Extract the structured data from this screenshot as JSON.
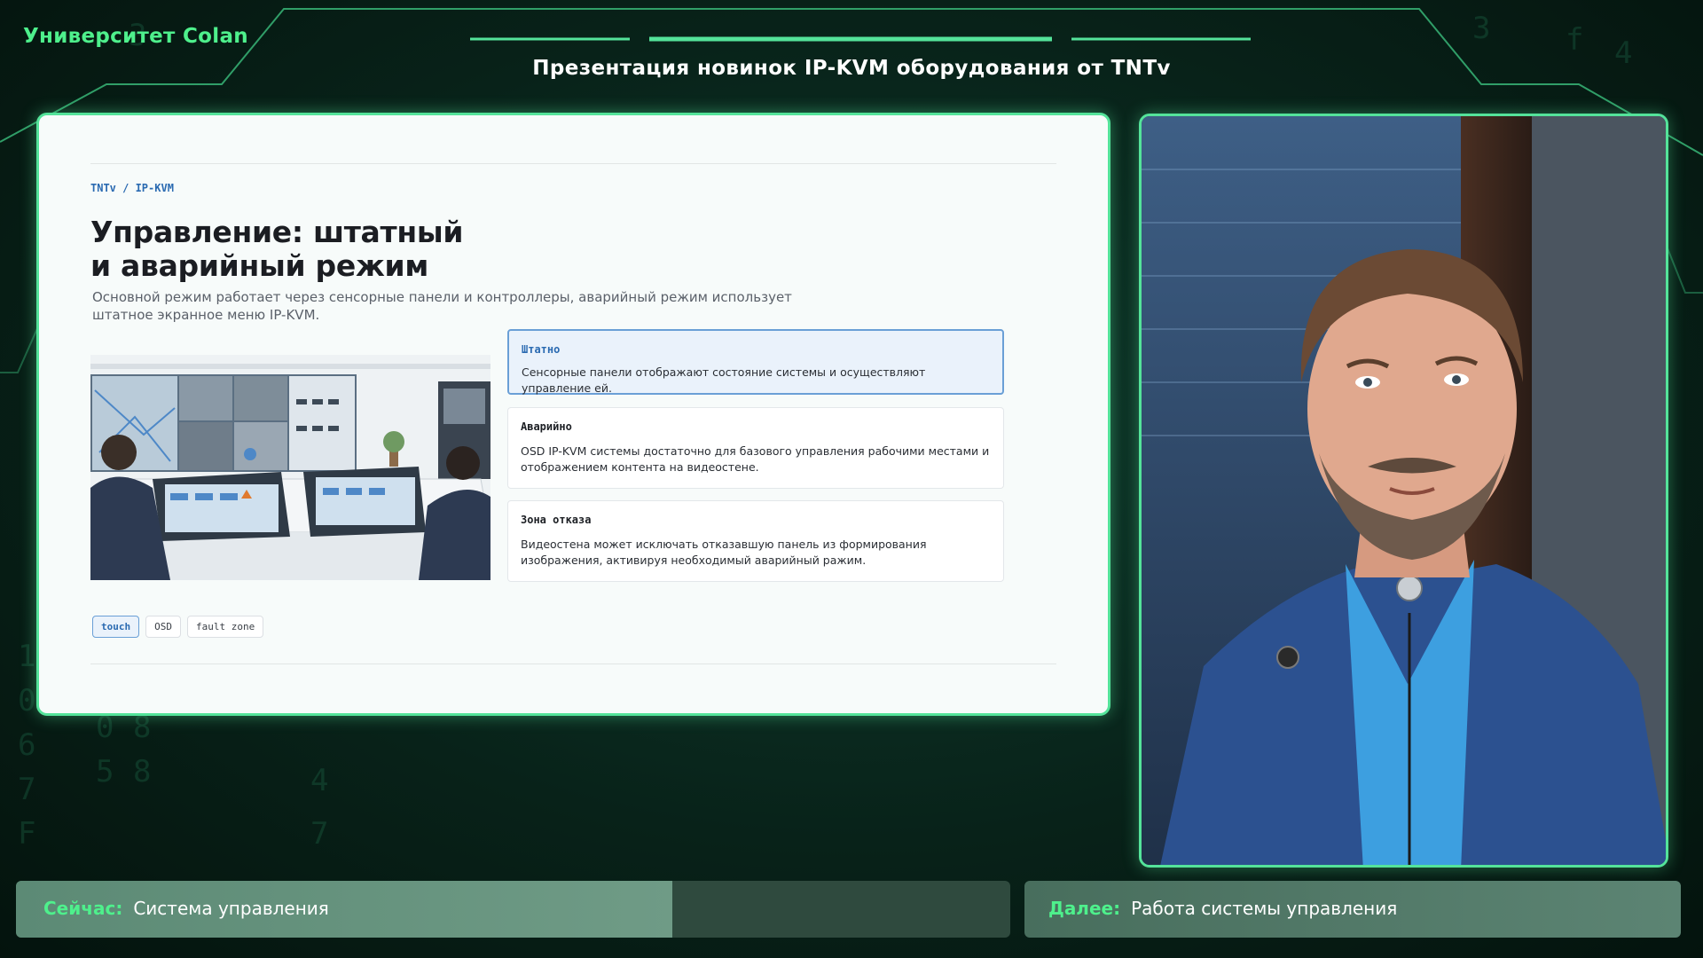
{
  "brand": "Университет Colan",
  "presentation_title": "Презентация новинок IP-KVM оборудования от TNTv",
  "slide": {
    "breadcrumb": "TNTv / IP-KVM",
    "heading_line1": "Управление: штатный",
    "heading_line2": "и аварийный режим",
    "subtitle": "Основной режим работает через сенсорные панели и контроллеры, аварийный режим использует штатное экранное меню IP-KVM.",
    "cards": [
      {
        "title": "Штатно",
        "text": "Сенсорные панели отображают состояние системы и осуществляют управление ей.",
        "active": true
      },
      {
        "title": "Аварийно",
        "text": "OSD IP-KVM системы достаточно для базового управления рабочими местами и отображением контента на видеостене.",
        "active": false
      },
      {
        "title": "Зона отказа",
        "text": "Видеостена может исключать отказавшую панель из формирования изображения, активируя необходимый аварийный ражим.",
        "active": false
      }
    ],
    "tags": [
      {
        "label": "touch",
        "active": true
      },
      {
        "label": "OSD",
        "active": false
      },
      {
        "label": "fault zone",
        "active": false
      }
    ]
  },
  "now_bar": {
    "label": "Сейчас:",
    "value": "Система управления",
    "progress": 0.66
  },
  "next_bar": {
    "label": "Далее:",
    "value": "Работа системы управления"
  },
  "colors": {
    "accent_green": "#4ef08c",
    "frame_green": "#54e39a",
    "link_blue": "#2a6ab1"
  }
}
